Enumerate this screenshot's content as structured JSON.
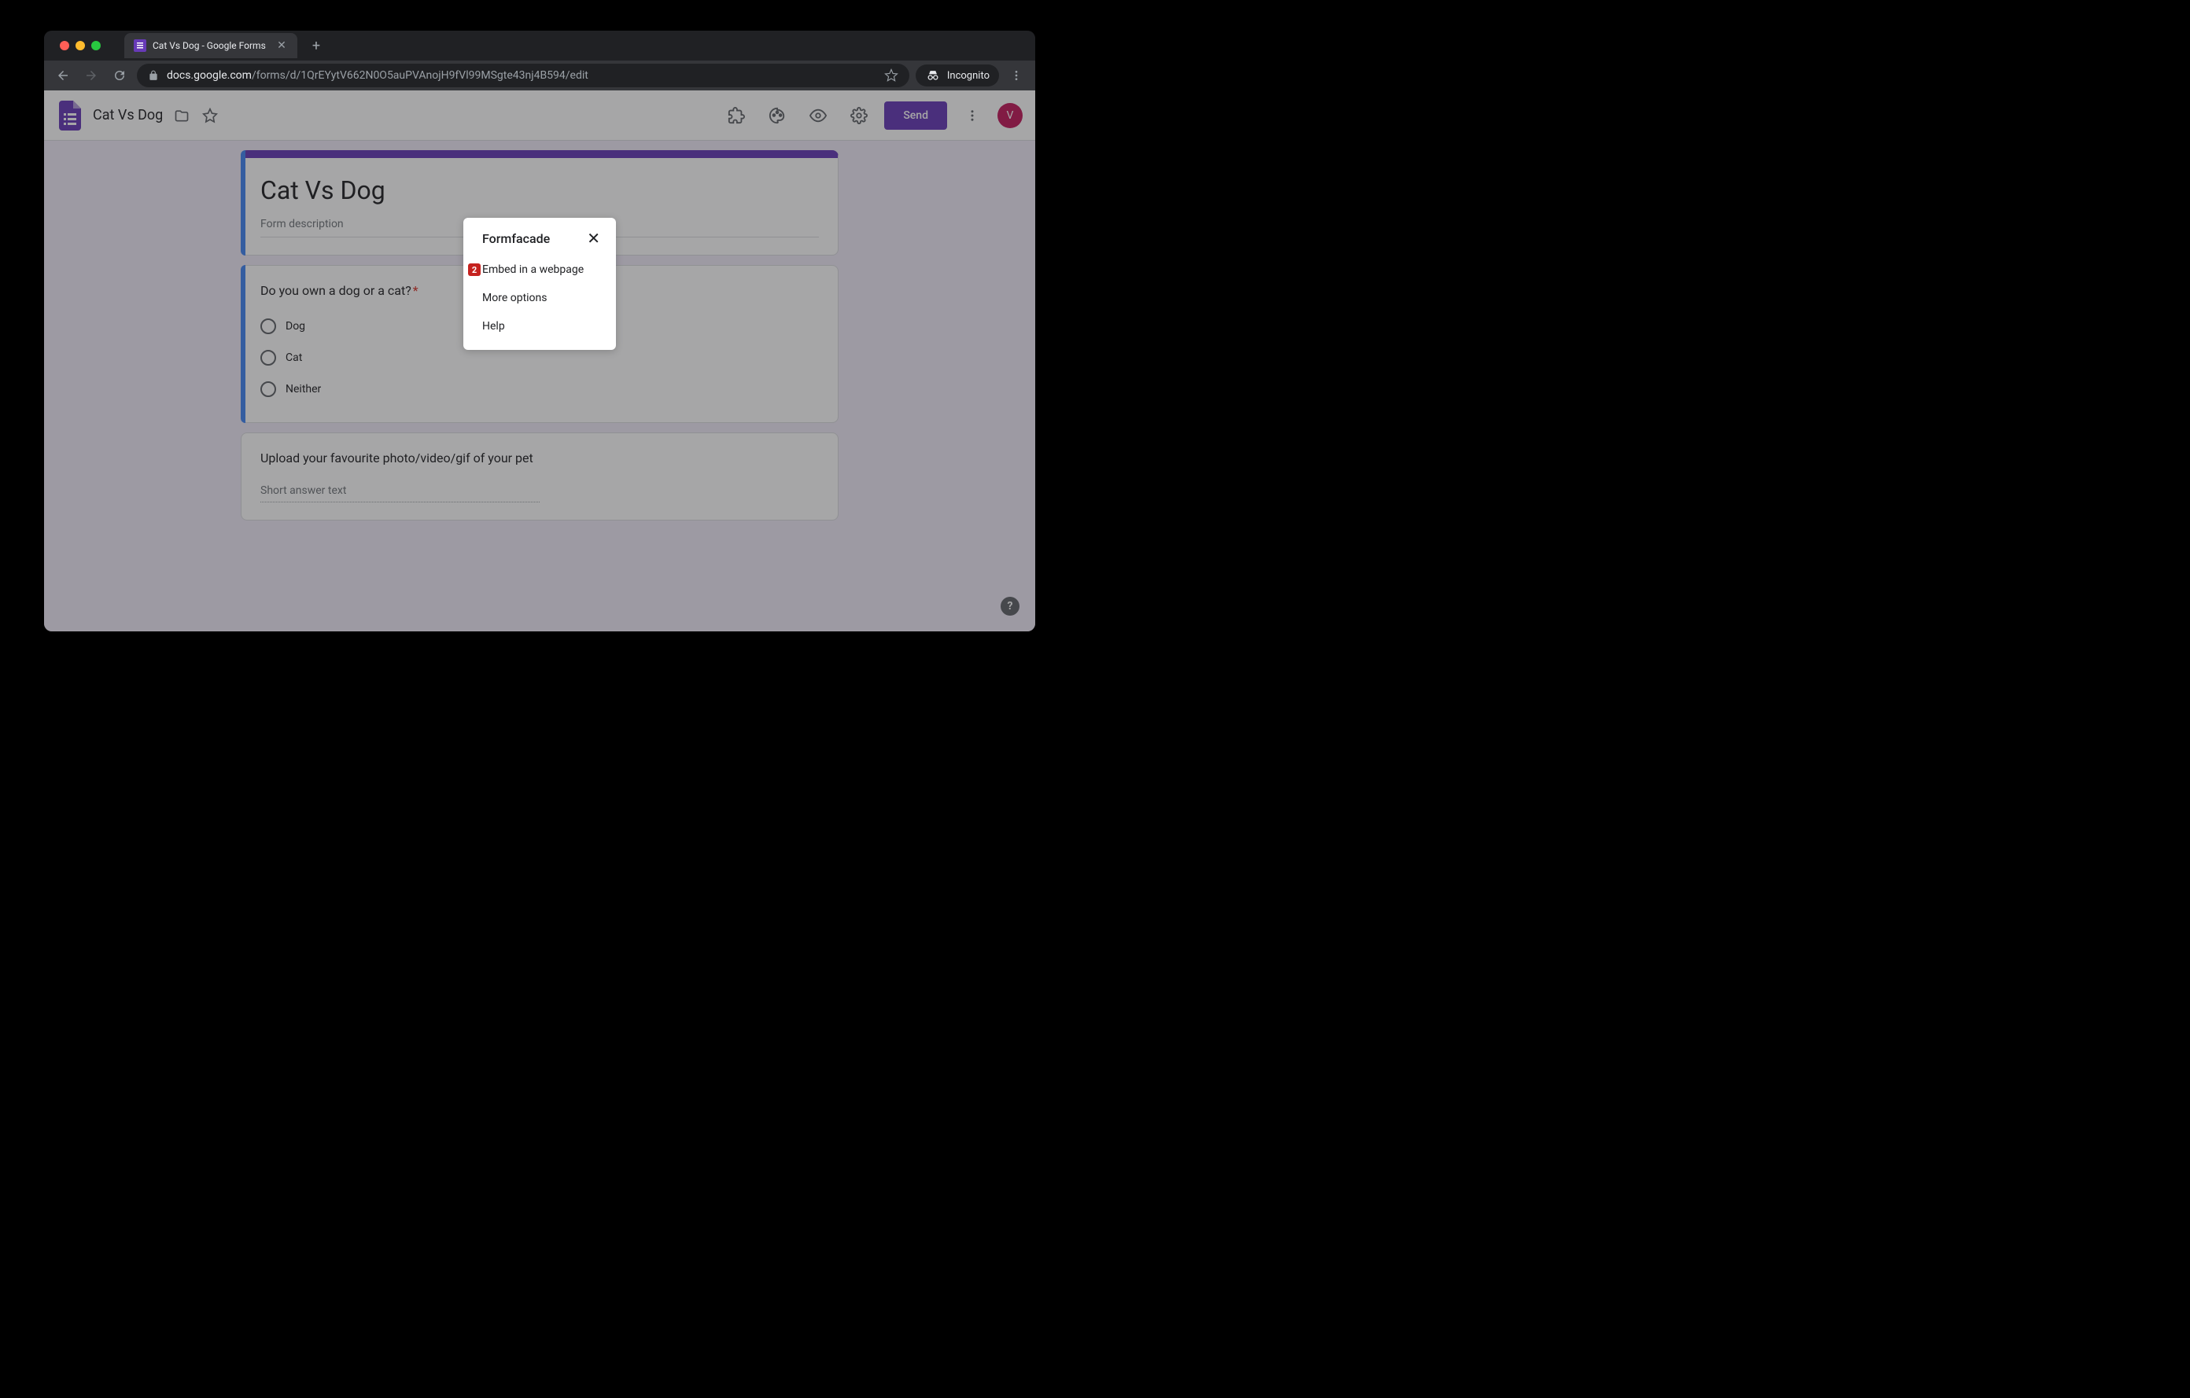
{
  "browser": {
    "tab_title": "Cat Vs Dog - Google Forms",
    "url_domain": "docs.google.com",
    "url_path": "/forms/d/1QrEYytV662N0O5auPVAnojH9fVl99MSgte43nj4B594/edit",
    "incognito_label": "Incognito"
  },
  "header": {
    "form_name": "Cat Vs Dog",
    "send_label": "Send",
    "avatar_initial": "V"
  },
  "form": {
    "title": "Cat Vs Dog",
    "description": "Form description",
    "q1": {
      "title": "Do you own a dog or a cat?",
      "options": [
        "Dog",
        "Cat",
        "Neither"
      ]
    },
    "q2": {
      "title": "Upload your favourite photo/video/gif of your pet",
      "answer_placeholder": "Short answer text"
    }
  },
  "popup": {
    "title": "Formfacade",
    "badge": "2",
    "items": [
      "Embed in a webpage",
      "More options",
      "Help"
    ]
  }
}
